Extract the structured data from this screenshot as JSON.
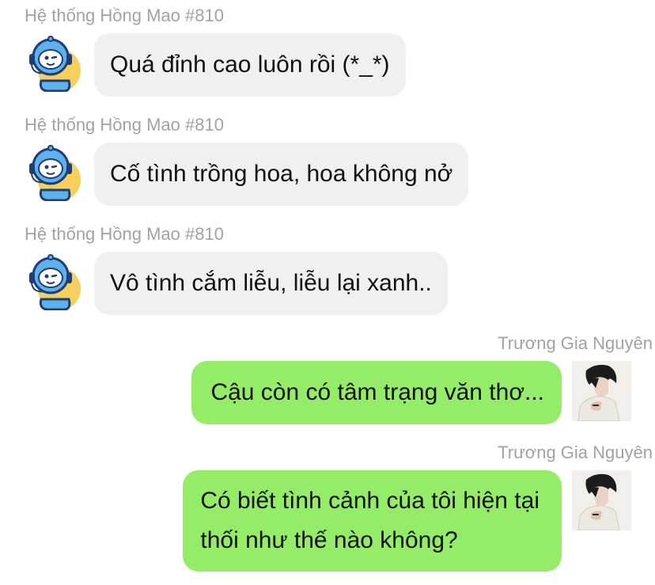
{
  "messages": [
    {
      "sender": "Hệ thống Hồng Mao #810",
      "text": "Quá đỉnh cao luôn rồi (*_*)"
    },
    {
      "sender": "Hệ thống Hồng Mao #810",
      "text": "Cố tình trồng hoa, hoa không nở"
    },
    {
      "sender": "Hệ thống Hồng Mao #810",
      "text": "Vô tình cắm liễu, liễu lại xanh.."
    },
    {
      "sender": "Trương Gia Nguyên",
      "text": "Cậu còn có tâm trạng văn thơ..."
    },
    {
      "sender": "Trương Gia Nguyên",
      "lines": [
        "Có biết tình cảnh của tôi hiện tại",
        "thối như thế nào không?"
      ]
    }
  ],
  "colors": {
    "incoming_bubble": "#f0f0f0",
    "outgoing_bubble": "#95ec69",
    "sender_name": "#a2a2a2",
    "message_text": "#111111"
  },
  "icons": {
    "bot_avatar": "robot-mascot-icon",
    "user_avatar": "user-photo"
  }
}
